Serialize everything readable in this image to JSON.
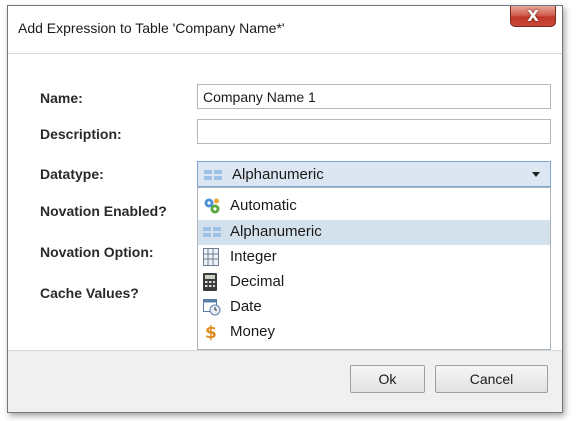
{
  "dialog": {
    "title": "Add Expression to Table 'Company Name*'",
    "close_label": "X"
  },
  "form": {
    "name_label": "Name:",
    "name_value": "Company Name 1",
    "description_label": "Description:",
    "description_value": "",
    "datatype_label": "Datatype:",
    "datatype_value": "Alphanumeric",
    "novation_enabled_label": "Novation Enabled?",
    "novation_option_label": "Novation Option:",
    "cache_values_label": "Cache Values?"
  },
  "dropdown": {
    "options": [
      {
        "label": "Automatic",
        "icon": "automatic-gears-icon",
        "selected": false
      },
      {
        "label": "Alphanumeric",
        "icon": "alphanumeric-icon",
        "selected": true
      },
      {
        "label": "Integer",
        "icon": "integer-icon",
        "selected": false
      },
      {
        "label": "Decimal",
        "icon": "decimal-calculator-icon",
        "selected": false
      },
      {
        "label": "Date",
        "icon": "date-calendar-icon",
        "selected": false
      },
      {
        "label": "Money",
        "icon": "money-dollar-icon",
        "selected": false
      }
    ]
  },
  "buttons": {
    "ok": "Ok",
    "cancel": "Cancel"
  },
  "colors": {
    "close_button": "#c7493b",
    "selected_item": "#d3e1ec",
    "select_focus": "#dbe6f2"
  }
}
